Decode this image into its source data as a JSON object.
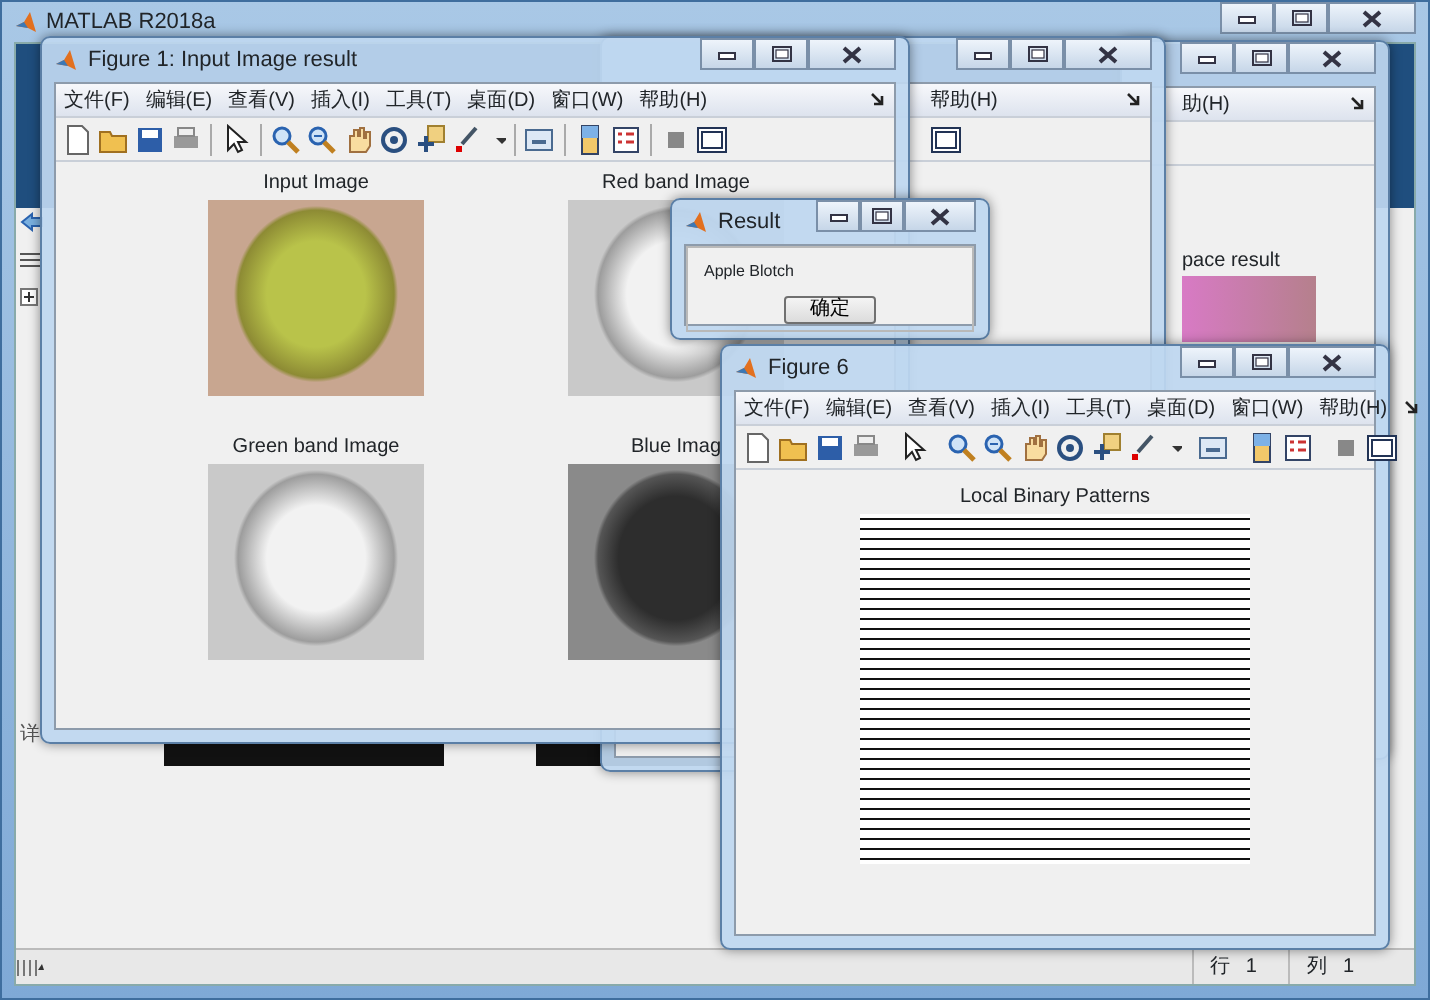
{
  "main_window": {
    "title": "MATLAB R2018a",
    "side_text": "详",
    "status_bar": {
      "row_label": "行",
      "row_value": "1",
      "col_label": "列",
      "col_value": "1"
    }
  },
  "background_windows": [
    {
      "menu_item": "帮助(H)"
    },
    {
      "menu_item": "助(H)",
      "axes": [
        {
          "title": "pace result",
          "kind": "pink"
        }
      ]
    }
  ],
  "figure_windows": [
    {
      "title": "Figure 1: Input Image result",
      "menu": [
        "文件(F)",
        "编辑(E)",
        "查看(V)",
        "插入(I)",
        "工具(T)",
        "桌面(D)",
        "窗口(W)",
        "帮助(H)"
      ],
      "axes": [
        {
          "title": "Input Image",
          "kind": "color"
        },
        {
          "title": "Red band Image",
          "kind": "gray"
        },
        {
          "title": "Green band Image",
          "kind": "gray"
        },
        {
          "title": "Blue Imag",
          "kind": "dark"
        }
      ]
    },
    {
      "title": "Figure 6",
      "menu": [
        "文件(F)",
        "编辑(E)",
        "查看(V)",
        "插入(I)",
        "工具(T)",
        "桌面(D)",
        "窗口(W)",
        "帮助(H)"
      ],
      "axes": [
        {
          "title": "Local Binary Patterns",
          "kind": "lbp"
        }
      ]
    }
  ],
  "dialog": {
    "title": "Result",
    "message": "Apple Blotch",
    "button": "确定"
  }
}
